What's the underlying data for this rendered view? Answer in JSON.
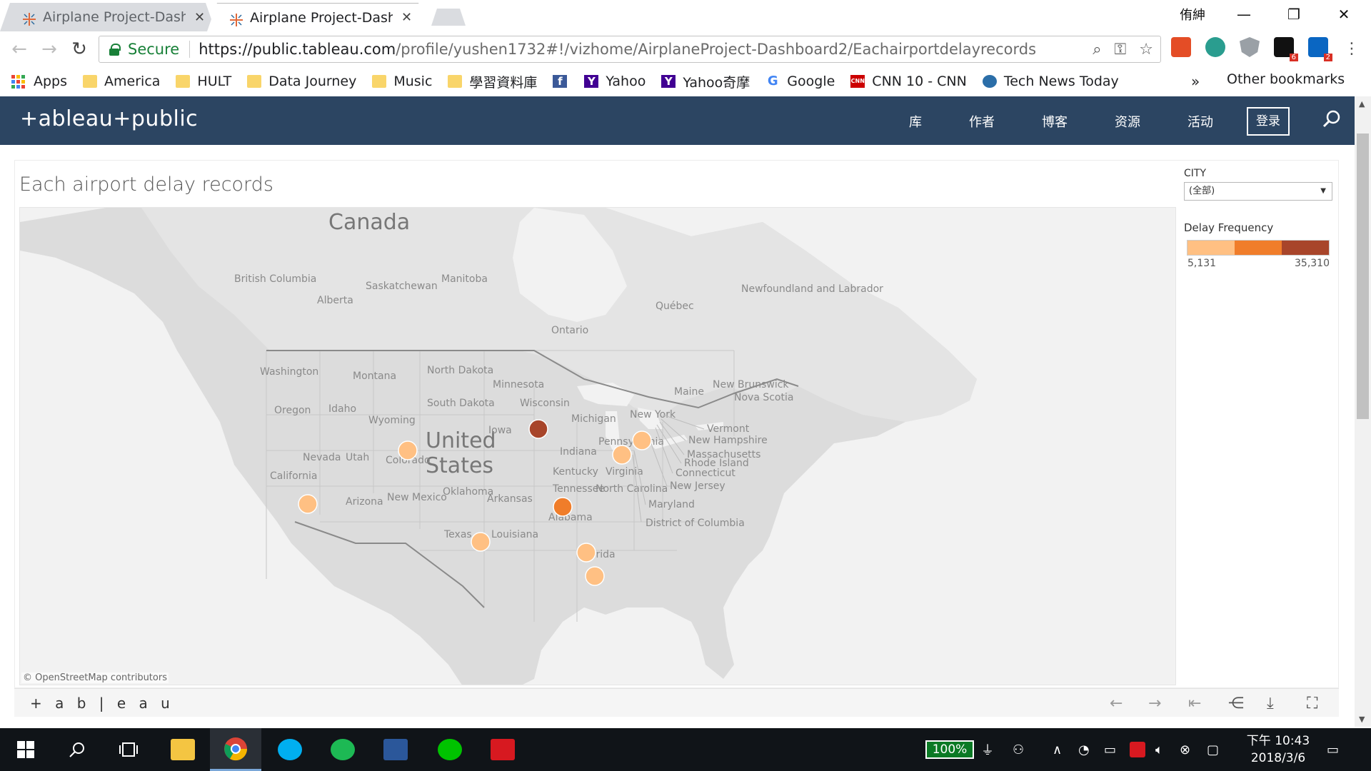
{
  "browser": {
    "tabs": [
      {
        "title": "Airplane Project-Dashb",
        "active": false
      },
      {
        "title": "Airplane Project-Dashb",
        "active": true
      }
    ],
    "window_user": "侑紳",
    "secure_label": "Secure",
    "url_host": "https://public.tableau.com",
    "url_path": "/profile/yushen1732#!/vizhome/AirplaneProject-Dashboard2/Eachairportdelayrecords",
    "bookmarks": [
      {
        "label": "Apps",
        "icon": "apps-icon"
      },
      {
        "label": "America",
        "icon": "folder-icon"
      },
      {
        "label": "HULT",
        "icon": "folder-icon"
      },
      {
        "label": "Data Journey",
        "icon": "folder-icon"
      },
      {
        "label": "Music",
        "icon": "folder-icon"
      },
      {
        "label": "學習資料庫",
        "icon": "folder-icon"
      },
      {
        "label": "",
        "icon": "facebook-icon"
      },
      {
        "label": "Yahoo",
        "icon": "yahoo-icon"
      },
      {
        "label": "Yahoo奇摩",
        "icon": "yahoo-icon"
      },
      {
        "label": "Google",
        "icon": "google-icon"
      },
      {
        "label": "CNN 10 - CNN",
        "icon": "cnn-icon"
      },
      {
        "label": "Tech News Today",
        "icon": "podcast-icon"
      }
    ],
    "bookmarks_more": "»",
    "other_bookmarks": "Other bookmarks",
    "badges": {
      "amazon": "6",
      "linkedin": "2"
    }
  },
  "tableau": {
    "logo": "+ableau+public",
    "nav": [
      "库",
      "作者",
      "博客",
      "资源",
      "活动"
    ],
    "login": "登录",
    "viz_title": "Each airport delay records",
    "filter_label": "CITY",
    "filter_value": "(全部)",
    "legend_title": "Delay Frequency",
    "legend_min": "5,131",
    "legend_max": "35,310",
    "legend_colors": [
      "#ffc083",
      "#f07d2a",
      "#a8452a"
    ],
    "attribution": "© OpenStreetMap contributors",
    "footer_logo": "+ a b | e a u"
  },
  "map": {
    "labels": {
      "canada": "Canada",
      "united": "United",
      "states": "States",
      "british_columbia": "British Columbia",
      "alberta": "Alberta",
      "saskatchewan": "Saskatchewan",
      "manitoba": "Manitoba",
      "ontario": "Ontario",
      "quebec": "Québec",
      "newfoundland": "Newfoundland and Labrador",
      "new_brunswick": "New Brunswick",
      "nova_scotia": "Nova Scotia",
      "maine": "Maine",
      "washington": "Washington",
      "montana": "Montana",
      "north_dakota": "North Dakota",
      "south_dakota": "South Dakota",
      "minnesota": "Minnesota",
      "wisconsin": "Wisconsin",
      "michigan": "Michigan",
      "oregon": "Oregon",
      "idaho": "Idaho",
      "wyoming": "Wyoming",
      "iowa": "Iowa",
      "indiana": "Indiana",
      "nevada": "Nevada",
      "utah": "Utah",
      "colorado": "Colorado",
      "california": "California",
      "arizona": "Arizona",
      "new_mexico": "New Mexico",
      "oklahoma": "Oklahoma",
      "arkansas": "Arkansas",
      "texas": "Texas",
      "louisiana": "Louisiana",
      "tennessee": "Tennessee",
      "alabama": "Alabama",
      "kentucky": "Kentucky",
      "virginia": "Virginia",
      "north_carolina": "North Carolina",
      "pennsylvania": "Pennsylvania",
      "new_york": "New York",
      "florida": "Florida",
      "vermont": "Vermont",
      "new_hampshire": "New Hampshire",
      "massachusetts": "Massachusetts",
      "rhode_island": "Rhode Island",
      "connecticut": "Connecticut",
      "new_jersey": "New Jersey",
      "maryland": "Maryland",
      "dc": "District of Columbia"
    },
    "airport_level_scale": [
      "low",
      "mid",
      "high"
    ],
    "airports": [
      {
        "location": "Chicago area",
        "level": "high"
      },
      {
        "location": "Atlanta area",
        "level": "mid"
      },
      {
        "location": "Denver area",
        "level": "low"
      },
      {
        "location": "Los Angeles area",
        "level": "low"
      },
      {
        "location": "Houston area",
        "level": "low"
      },
      {
        "location": "New York area",
        "level": "low"
      },
      {
        "location": "Washington DC area",
        "level": "low"
      },
      {
        "location": "Orlando area",
        "level": "low"
      },
      {
        "location": "Miami area",
        "level": "low"
      }
    ]
  },
  "taskbar": {
    "battery": "100%",
    "time": "下午 10:43",
    "date": "2018/3/6"
  }
}
